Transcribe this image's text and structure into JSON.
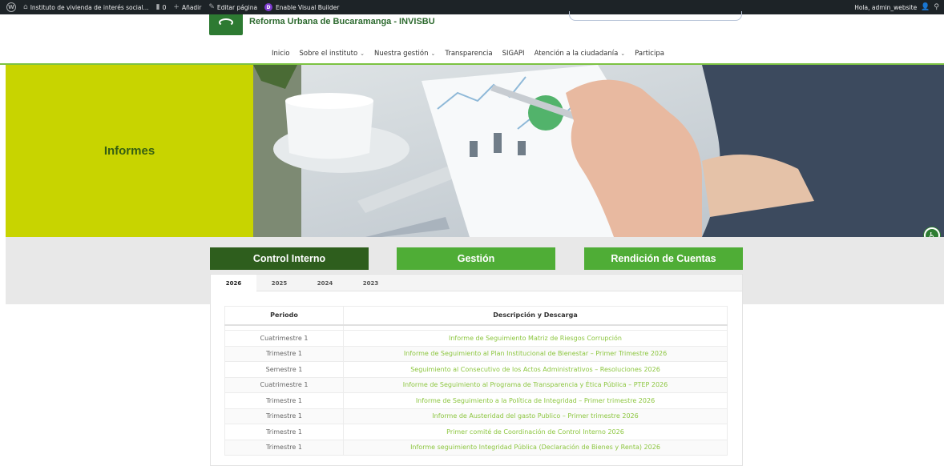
{
  "admin_bar": {
    "site_name": "Instituto de vivienda de interés social...",
    "comments_count": "0",
    "add_new": "Añadir",
    "edit_page": "Editar página",
    "visual_builder": "Enable Visual Builder",
    "greeting": "Hola, admin_website"
  },
  "header": {
    "site_title": "Reforma Urbana de Bucaramanga - INVISBU",
    "nav": [
      {
        "label": "Inicio",
        "dropdown": false
      },
      {
        "label": "Sobre el instituto",
        "dropdown": true
      },
      {
        "label": "Nuestra gestión",
        "dropdown": true
      },
      {
        "label": "Transparencia",
        "dropdown": false
      },
      {
        "label": "SIGAPI",
        "dropdown": false
      },
      {
        "label": "Atención a la ciudadanía",
        "dropdown": true
      },
      {
        "label": "Participa",
        "dropdown": false
      }
    ]
  },
  "hero": {
    "title": "Informes"
  },
  "categories": [
    {
      "label": "Control Interno",
      "active": true
    },
    {
      "label": "Gestión",
      "active": false
    },
    {
      "label": "Rendición de Cuentas",
      "active": false
    }
  ],
  "year_tabs": [
    {
      "label": "2026",
      "active": true
    },
    {
      "label": "2025",
      "active": false
    },
    {
      "label": "2024",
      "active": false
    },
    {
      "label": "2023",
      "active": false
    }
  ],
  "table": {
    "headers": {
      "period": "Periodo",
      "description": "Descripción y Descarga"
    },
    "rows": [
      {
        "period": "Cuatrimestre 1",
        "description": "Informe de Seguimiento Matriz de Riesgos Corrupción"
      },
      {
        "period": "Trimestre 1",
        "description": "Informe de Seguimiento al Plan Institucional de Bienestar – Primer Trimestre 2026"
      },
      {
        "period": "Semestre 1",
        "description": "Seguimiento al Consecutivo de los Actos Administrativos – Resoluciones 2026"
      },
      {
        "period": "Cuatrimestre 1",
        "description": "Informe de Seguimiento al Programa de Transparencia y Ética Pública – PTEP 2026"
      },
      {
        "period": "Trimestre 1",
        "description": "Informe de Seguimiento a la Política de Integridad – Primer trimestre 2026"
      },
      {
        "period": "Trimestre 1",
        "description": "Informe de Austeridad del gasto Publico – Primer trimestre 2026"
      },
      {
        "period": "Trimestre 1",
        "description": "Primer comité de Coordinación de Control Interno 2026"
      },
      {
        "period": "Trimestre 1",
        "description": "Informe seguimiento Integridad Pública (Declaración de Bienes y Renta) 2026"
      }
    ]
  },
  "colors": {
    "hero_panel": "#c8d400",
    "category_active": "#2e5e1d",
    "category_normal": "#4fad36",
    "link_green": "#8cc63f",
    "admin_bar": "#1d2327"
  }
}
